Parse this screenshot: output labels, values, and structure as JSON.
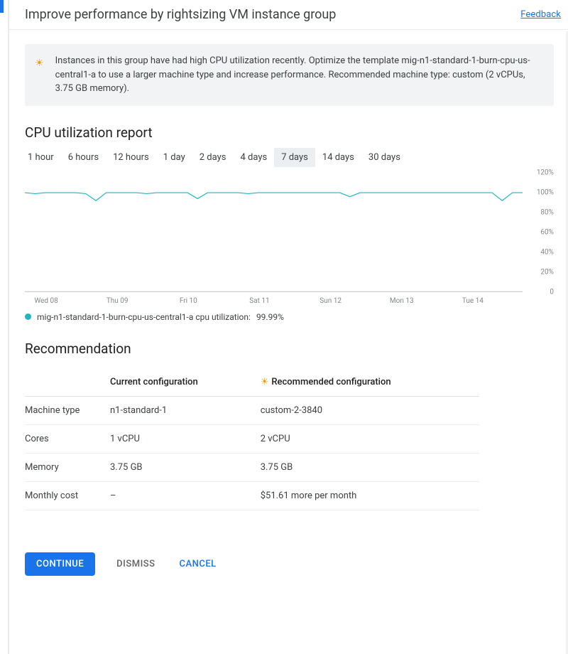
{
  "header": {
    "title": "Improve performance by rightsizing VM instance group",
    "feedback": "Feedback"
  },
  "banner": {
    "text": "Instances in this group have had high CPU utilization recently. Optimize the template mig-n1-standard-1-burn-cpu-us-central1-a to use a larger machine type and increase performance. Recommended machine type: custom (2 vCPUs, 3.75 GB memory)."
  },
  "report": {
    "title": "CPU utilization report",
    "ranges": [
      "1 hour",
      "6 hours",
      "12 hours",
      "1 day",
      "2 days",
      "4 days",
      "7 days",
      "14 days",
      "30 days"
    ],
    "selected_range": "7 days",
    "legend_series": "mig-n1-standard-1-burn-cpu-us-central1-a cpu utilization:",
    "legend_value": "99.99%"
  },
  "recommendation": {
    "title": "Recommendation",
    "col_current": "Current configuration",
    "col_recommended": "Recommended configuration",
    "rows": [
      {
        "label": "Machine type",
        "current": "n1-standard-1",
        "recommended": "custom-2-3840"
      },
      {
        "label": "Cores",
        "current": "1 vCPU",
        "recommended": "2 vCPU"
      },
      {
        "label": "Memory",
        "current": "3.75 GB",
        "recommended": "3.75 GB"
      },
      {
        "label": "Monthly cost",
        "current": "–",
        "recommended": "$51.61 more per month"
      }
    ]
  },
  "actions": {
    "continue": "CONTINUE",
    "dismiss": "DISMISS",
    "cancel": "CANCEL"
  },
  "chart_data": {
    "type": "line",
    "title": "CPU utilization report",
    "ylabel": "",
    "ylim": [
      0,
      120
    ],
    "ytick_labels": [
      "0",
      "20%",
      "40%",
      "60%",
      "80%",
      "100%",
      "120%"
    ],
    "xtick_labels": [
      "Wed 08",
      "Thu 09",
      "Fri 10",
      "Sat 11",
      "Sun 12",
      "Mon 13",
      "Tue 14"
    ],
    "series": [
      {
        "name": "mig-n1-standard-1-burn-cpu-us-central1-a cpu utilization",
        "color": "#1fb6c1",
        "x": [
          0,
          1,
          2,
          3,
          4,
          5,
          6,
          7,
          8,
          9,
          10,
          11,
          12,
          13,
          14,
          15,
          16,
          17,
          18,
          19,
          20,
          21,
          22,
          23,
          24,
          25,
          26,
          27,
          28,
          29,
          30,
          31,
          32,
          33,
          34,
          35,
          36,
          37,
          38,
          39,
          40,
          41,
          42,
          43,
          44,
          45,
          46,
          47,
          48,
          49
        ],
        "y": [
          100,
          99,
          100,
          100,
          100,
          100,
          99,
          92,
          100,
          100,
          100,
          100,
          99,
          100,
          100,
          100,
          100,
          94,
          100,
          100,
          100,
          100,
          99,
          100,
          100,
          100,
          100,
          100,
          100,
          100,
          100,
          100,
          96,
          100,
          100,
          100,
          100,
          100,
          100,
          100,
          100,
          100,
          100,
          100,
          100,
          100,
          100,
          92,
          100,
          100
        ]
      }
    ]
  }
}
